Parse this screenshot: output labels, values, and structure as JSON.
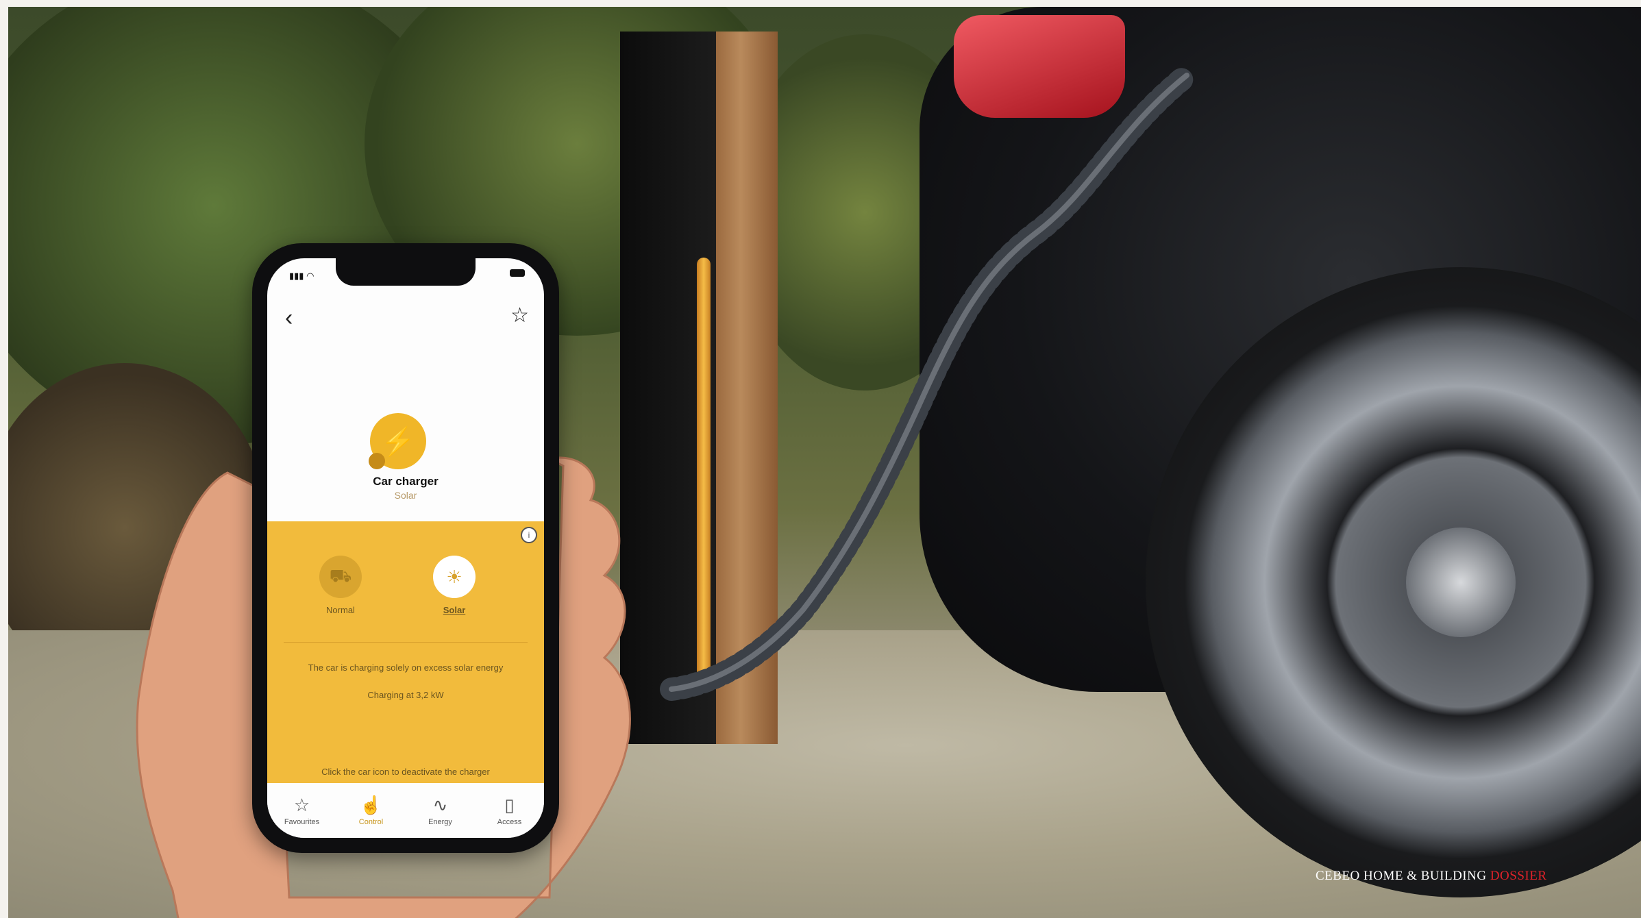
{
  "app": {
    "device_name": "Car charger",
    "device_mode": "Solar",
    "modes": [
      {
        "label": "Normal",
        "icon": "car-icon"
      },
      {
        "label": "Solar",
        "icon": "sun-icon"
      }
    ],
    "description": "The car is charging solely on excess solar energy",
    "charging_status": "Charging at 3,2 kW",
    "hint": "Click the car icon to deactivate the charger",
    "tabs": [
      {
        "label": "Favourites",
        "icon": "star-icon"
      },
      {
        "label": "Control",
        "icon": "hand-icon"
      },
      {
        "label": "Energy",
        "icon": "energy-icon"
      },
      {
        "label": "Access",
        "icon": "door-icon"
      }
    ],
    "accent": "#f2bb3c"
  },
  "footer": {
    "brand": "CEBEO HOME & BUILDING ",
    "brand_highlight": "DOSSIER"
  }
}
